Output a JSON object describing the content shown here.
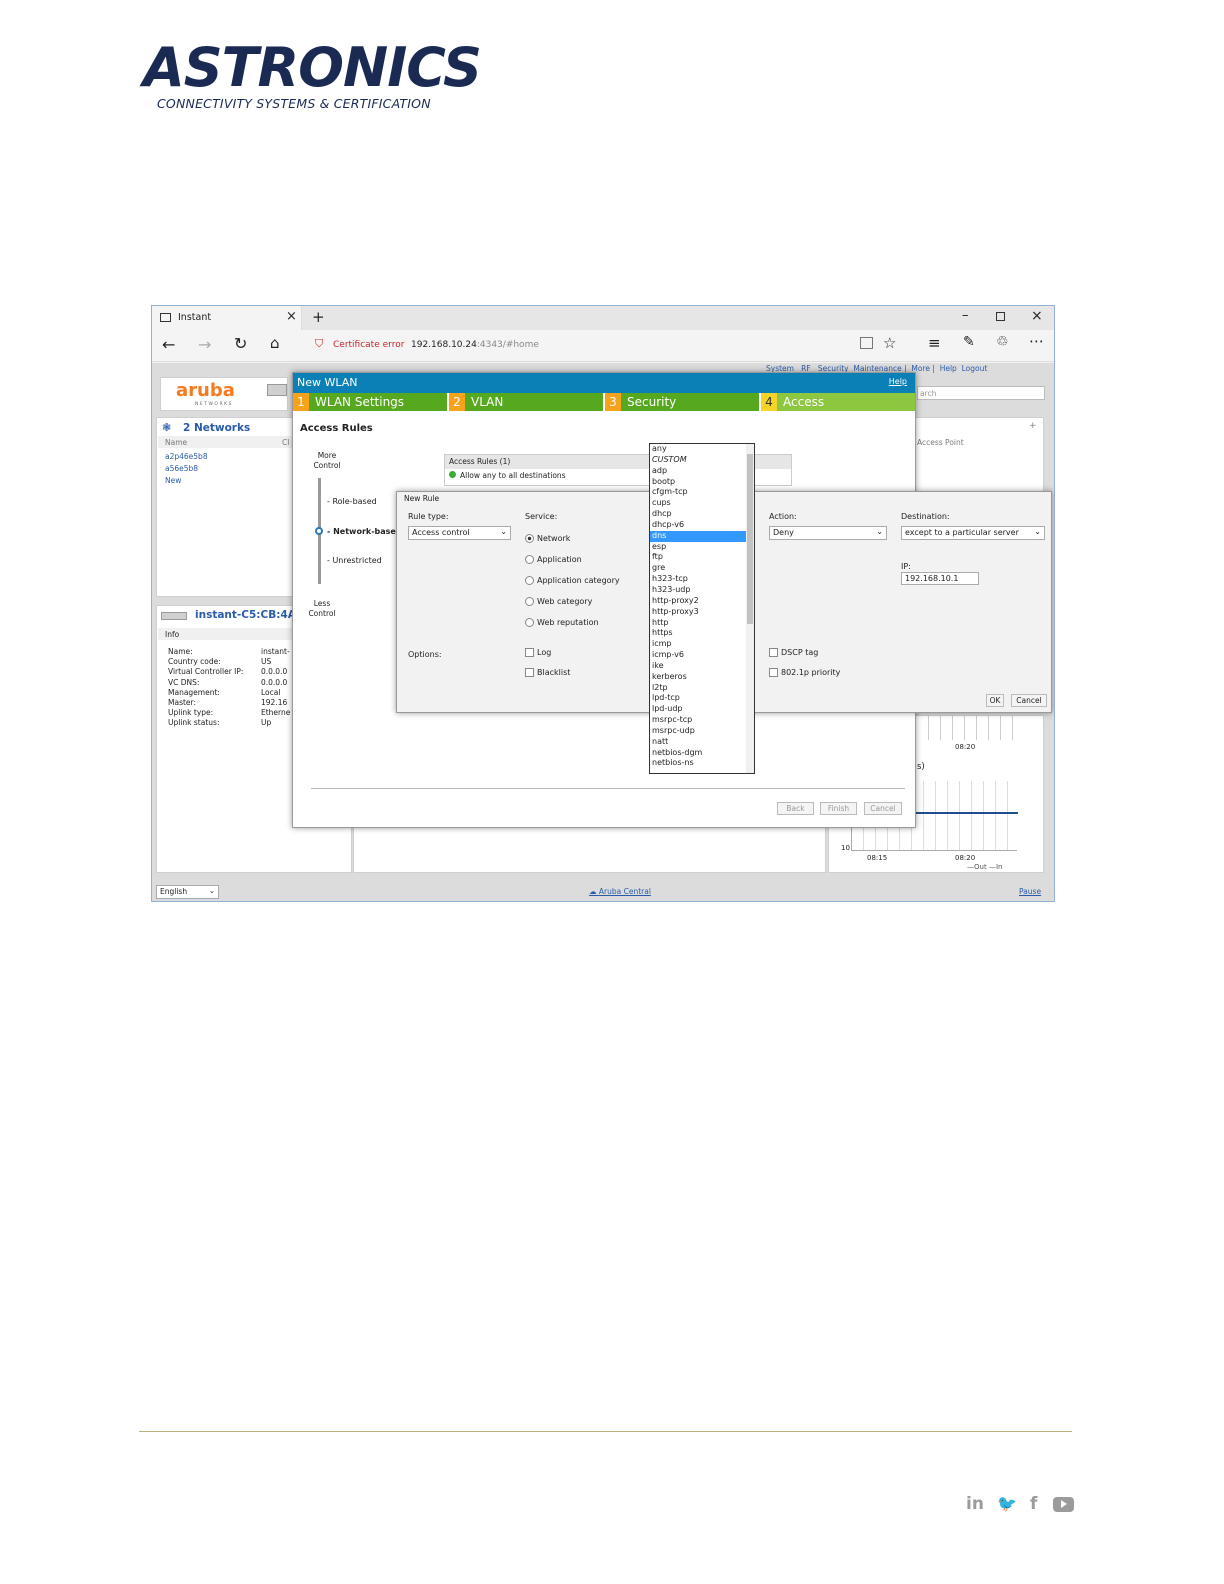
{
  "brand": {
    "name": "ASTRONICS",
    "tagline": "CONNECTIVITY SYSTEMS & CERTIFICATION"
  },
  "browser": {
    "tab_title": "Instant",
    "cert_error": "Certificate error",
    "url_host": "192.168.10.24",
    "url_rest": ":4343/#home"
  },
  "app": {
    "logo": "aruba",
    "logo_sub": "NETWORKS",
    "topnav": [
      "System",
      "RF",
      "Security",
      "Maintenance",
      "More",
      "Help",
      "Logout"
    ],
    "search_placeholder": "arch",
    "networks_title": "2 Networks",
    "networks_col_name": "Name",
    "networks_col2": "Cl",
    "networks": [
      "a2p46e5b8",
      "a56e5b8",
      "New"
    ],
    "access_point_col": "Access Point",
    "device_title": "instant-C5:CB:4A",
    "info_tab": "Info",
    "info": [
      {
        "k": "Name:",
        "v": "instant-"
      },
      {
        "k": "Country code:",
        "v": "US"
      },
      {
        "k": "Virtual Controller IP:",
        "v": "0.0.0.0"
      },
      {
        "k": "VC DNS:",
        "v": "0.0.0.0"
      },
      {
        "k": "Management:",
        "v": "Local"
      },
      {
        "k": "Master:",
        "v": "192.16"
      },
      {
        "k": "Uplink type:",
        "v": "Etherne"
      },
      {
        "k": "Uplink status:",
        "v": "Up"
      }
    ],
    "chart_times": [
      "08:15",
      "08:20",
      "08:20"
    ],
    "chart_y": "10",
    "chart_suffix": "s)",
    "legend_out": "Out",
    "legend_in": "In",
    "language": "English",
    "aruba_central": "Aruba Central",
    "pause": "Pause"
  },
  "wizard": {
    "title": "New WLAN",
    "help": "Help",
    "steps": [
      {
        "n": "1",
        "label": "WLAN Settings"
      },
      {
        "n": "2",
        "label": "VLAN"
      },
      {
        "n": "3",
        "label": "Security"
      },
      {
        "n": "4",
        "label": "Access"
      }
    ],
    "section_title": "Access Rules",
    "more_control": "More Control",
    "levels": [
      "Role-based",
      "Network-based",
      "Unrestricted"
    ],
    "less_control": "Less Control",
    "rules_header": "Access Rules (1)",
    "rule_1": "Allow any to all destinations",
    "back": "Back",
    "finish": "Finish",
    "cancel": "Cancel"
  },
  "new_rule": {
    "title": "New Rule",
    "rule_type_label": "Rule type:",
    "rule_type_value": "Access control",
    "service_label": "Service:",
    "services": [
      "Network",
      "Application",
      "Application category",
      "Web category",
      "Web reputation"
    ],
    "action_label": "Action:",
    "action_value": "Deny",
    "destination_label": "Destination:",
    "destination_value": "except to a particular server",
    "ip_label": "IP:",
    "ip_value": "192.168.10.1",
    "options_label": "Options:",
    "opt_log": "Log",
    "opt_blacklist": "Blacklist",
    "opt_dscp": "DSCP tag",
    "opt_8021p": "802.1p priority",
    "ok": "OK",
    "cancel": "Cancel"
  },
  "service_dropdown": {
    "selected": "dns",
    "options": [
      "any",
      "CUSTOM",
      "adp",
      "bootp",
      "cfgm-tcp",
      "cups",
      "dhcp",
      "dhcp-v6",
      "dns",
      "esp",
      "ftp",
      "gre",
      "h323-tcp",
      "h323-udp",
      "http-proxy2",
      "http-proxy3",
      "http",
      "https",
      "icmp",
      "icmp-v6",
      "ike",
      "kerberos",
      "l2tp",
      "lpd-tcp",
      "lpd-udp",
      "msrpc-tcp",
      "msrpc-udp",
      "natt",
      "netbios-dgm",
      "netbios-ns"
    ]
  },
  "footer": {
    "social": [
      "in",
      "twitter-icon",
      "f",
      "youtube-icon"
    ]
  }
}
